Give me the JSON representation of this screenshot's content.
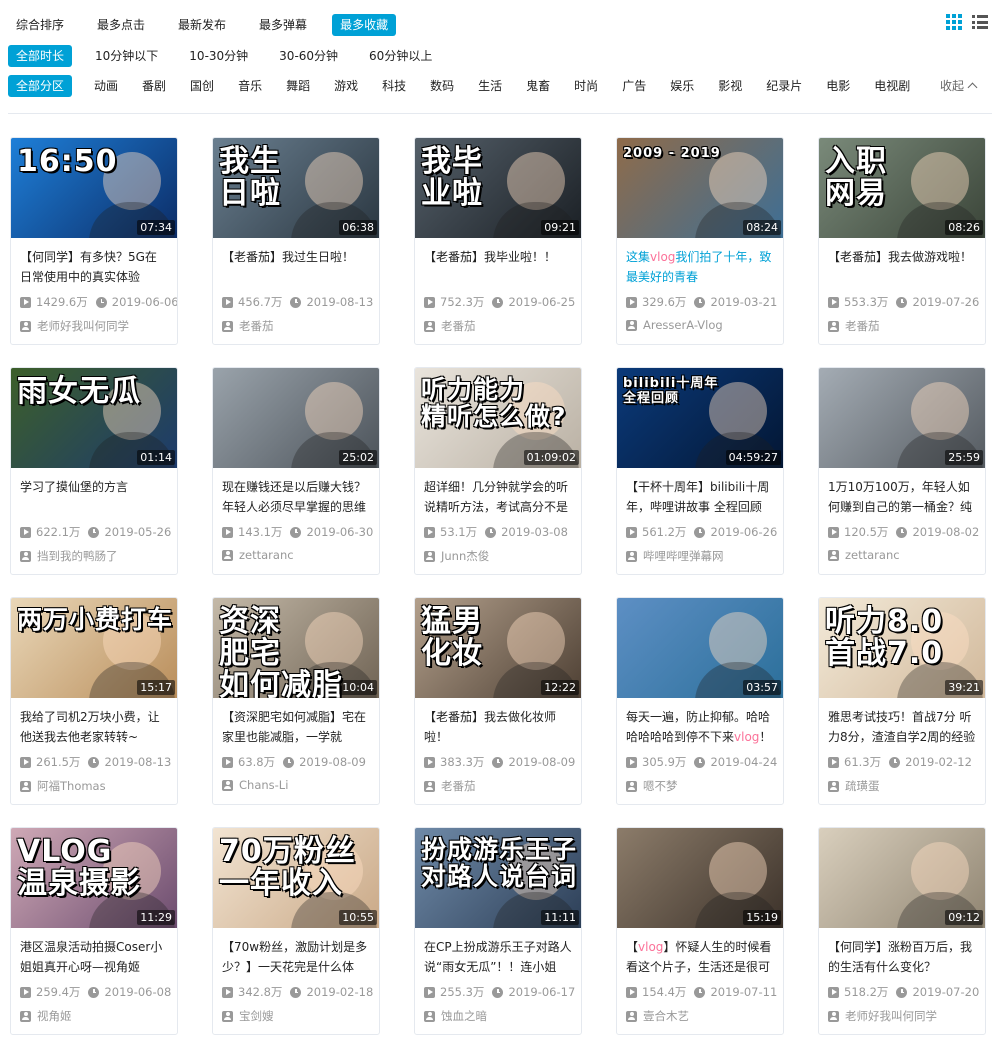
{
  "sort_tabs": [
    {
      "label": "综合排序",
      "active": false
    },
    {
      "label": "最多点击",
      "active": false
    },
    {
      "label": "最新发布",
      "active": false
    },
    {
      "label": "最多弹幕",
      "active": false
    },
    {
      "label": "最多收藏",
      "active": true
    }
  ],
  "duration_filters": [
    {
      "label": "全部时长",
      "active": true
    },
    {
      "label": "10分钟以下",
      "active": false
    },
    {
      "label": "10-30分钟",
      "active": false
    },
    {
      "label": "30-60分钟",
      "active": false
    },
    {
      "label": "60分钟以上",
      "active": false
    }
  ],
  "zone_filters": [
    {
      "label": "全部分区",
      "active": true
    },
    {
      "label": "动画",
      "active": false
    },
    {
      "label": "番剧",
      "active": false
    },
    {
      "label": "国创",
      "active": false
    },
    {
      "label": "音乐",
      "active": false
    },
    {
      "label": "舞蹈",
      "active": false
    },
    {
      "label": "游戏",
      "active": false
    },
    {
      "label": "科技",
      "active": false
    },
    {
      "label": "数码",
      "active": false
    },
    {
      "label": "生活",
      "active": false
    },
    {
      "label": "鬼畜",
      "active": false
    },
    {
      "label": "时尚",
      "active": false
    },
    {
      "label": "广告",
      "active": false
    },
    {
      "label": "娱乐",
      "active": false
    },
    {
      "label": "影视",
      "active": false
    },
    {
      "label": "纪录片",
      "active": false
    },
    {
      "label": "电影",
      "active": false
    },
    {
      "label": "电视剧",
      "active": false
    }
  ],
  "collapse_label": "收起",
  "colors": {
    "accent": "#00a1d6",
    "highlight_pink": "#fb7299"
  },
  "videos": [
    {
      "title_parts": [
        [
          "【何同学】有多快？5G在日常使用中的真实体验",
          ""
        ]
      ],
      "thumb_text": "16:50",
      "duration": "07:34",
      "views": "1429.6万",
      "date": "2019-06-06",
      "author": "老师好我叫何同学",
      "bg": [
        "#1e7fd8",
        "#0c2c66"
      ]
    },
    {
      "title_parts": [
        [
          "【老番茄】我过生日啦！",
          ""
        ]
      ],
      "thumb_text": "我生\n日啦",
      "duration": "06:38",
      "views": "456.7万",
      "date": "2019-08-13",
      "author": "老番茄",
      "bg": [
        "#6a7f90",
        "#2a3640"
      ]
    },
    {
      "title_parts": [
        [
          "【老番茄】我毕业啦！！",
          ""
        ]
      ],
      "thumb_text": "我毕\n业啦",
      "duration": "09:21",
      "views": "752.3万",
      "date": "2019-06-25",
      "author": "老番茄",
      "bg": [
        "#55606a",
        "#1a1f24"
      ]
    },
    {
      "title_parts": [
        [
          "这集",
          "hl"
        ],
        [
          "vlog",
          "hl2"
        ],
        [
          "我们拍了十年，致最美好的青春",
          "hl"
        ]
      ],
      "thumb_text": "2009 - 2019",
      "duration": "08:24",
      "views": "329.6万",
      "date": "2019-03-21",
      "author": "AresserA-Vlog",
      "bg": [
        "#8f6b4a",
        "#3d6f96"
      ]
    },
    {
      "title_parts": [
        [
          "【老番茄】我去做游戏啦！",
          ""
        ]
      ],
      "thumb_text": "入职\n网易",
      "duration": "08:26",
      "views": "553.3万",
      "date": "2019-07-26",
      "author": "老番茄",
      "bg": [
        "#7a8a7a",
        "#3a4438"
      ]
    },
    {
      "title_parts": [
        [
          "学习了摸仙堡的方言",
          ""
        ]
      ],
      "thumb_text": "雨女无瓜",
      "duration": "01:14",
      "views": "622.1万",
      "date": "2019-05-26",
      "author": "挡到我的鸭肠了",
      "bg": [
        "#3d5f2a",
        "#1c3a6d"
      ]
    },
    {
      "title_parts": [
        [
          "现在赚钱还是以后赚大钱？年轻人必须尽早掌握的思维",
          ""
        ]
      ],
      "thumb_text": "",
      "duration": "25:02",
      "views": "143.1万",
      "date": "2019-06-30",
      "author": "zettaranc",
      "bg": [
        "#9aa3ab",
        "#4b5259"
      ]
    },
    {
      "title_parts": [
        [
          "超详细！几分钟就学会的听说精听方法，考试高分不是梦",
          ""
        ]
      ],
      "thumb_text": "听力能力\n精听怎么做?",
      "duration": "01:09:02",
      "views": "53.1万",
      "date": "2019-03-08",
      "author": "Junn杰俊",
      "bg": [
        "#e9e4dc",
        "#b9b0a3"
      ]
    },
    {
      "title_parts": [
        [
          "【干杯十周年】bilibili十周年，哔哩讲故事 全程回顾",
          ""
        ]
      ],
      "thumb_text": "bilibili十周年\n全程回顾",
      "duration": "04:59:27",
      "views": "561.2万",
      "date": "2019-06-26",
      "author": "哔哩哔哩弹幕网",
      "bg": [
        "#0b3a7a",
        "#031633"
      ]
    },
    {
      "title_parts": [
        [
          "1万10万100万，年轻人如何赚到自己的第一桶金？纯",
          ""
        ]
      ],
      "thumb_text": "",
      "duration": "25:59",
      "views": "120.5万",
      "date": "2019-08-02",
      "author": "zettaranc",
      "bg": [
        "#a4acb4",
        "#545a60"
      ]
    },
    {
      "title_parts": [
        [
          "我给了司机2万块小费，让他送我去他老家转转~",
          ""
        ]
      ],
      "thumb_text": "两万小费打车",
      "duration": "15:17",
      "views": "261.5万",
      "date": "2019-08-13",
      "author": "阿福Thomas",
      "bg": [
        "#e9d7b8",
        "#b98d5a"
      ]
    },
    {
      "title_parts": [
        [
          "【资深肥宅如何减脂】宅在家里也能减脂，一学就",
          ""
        ]
      ],
      "thumb_text": "资深\n肥宅\n如何减脂",
      "duration": "10:04",
      "views": "63.8万",
      "date": "2019-08-09",
      "author": "Chans-Li",
      "bg": [
        "#c4b9a8",
        "#6f6354"
      ]
    },
    {
      "title_parts": [
        [
          "【老番茄】我去做化妆师啦！",
          ""
        ]
      ],
      "thumb_text": "猛男\n化妆",
      "duration": "12:22",
      "views": "383.3万",
      "date": "2019-08-09",
      "author": "老番茄",
      "bg": [
        "#b3a08c",
        "#4d3f33"
      ]
    },
    {
      "title_parts": [
        [
          "每天一遍，防止抑郁。哈哈哈哈哈哈到停不下来",
          ""
        ],
        [
          "vlog",
          "hl2"
        ],
        [
          "！",
          ""
        ]
      ],
      "thumb_text": "",
      "duration": "03:57",
      "views": "305.9万",
      "date": "2019-04-24",
      "author": "嗯不梦",
      "bg": [
        "#5d8fc4",
        "#2b6f9a"
      ]
    },
    {
      "title_parts": [
        [
          "雅思考试技巧！首战7分 听力8分，渣渣自学2周的经验",
          ""
        ]
      ],
      "thumb_text": "听力8.0\n首战7.0",
      "duration": "39:21",
      "views": "61.3万",
      "date": "2019-02-12",
      "author": "疏璜蛋",
      "bg": [
        "#f3ead9",
        "#d1b89a"
      ]
    },
    {
      "title_parts": [
        [
          "港区温泉活动拍摄Coser小姐姐真开心呀—视角姬",
          ""
        ]
      ],
      "thumb_text": "VLOG\n温泉摄影",
      "duration": "11:29",
      "views": "259.4万",
      "date": "2019-06-08",
      "author": "视角姬",
      "bg": [
        "#cfa9b6",
        "#6b4b6e"
      ]
    },
    {
      "title_parts": [
        [
          "【70w粉丝，激励计划是多少？】一天花完是什么体",
          ""
        ]
      ],
      "thumb_text": "70万粉丝\n一年收入",
      "duration": "10:55",
      "views": "342.8万",
      "date": "2019-02-18",
      "author": "宝剑嫂",
      "bg": [
        "#f2e4d2",
        "#c9a886"
      ]
    },
    {
      "title_parts": [
        [
          "在CP上扮成游乐王子对路人说“雨女无瓜”！！连小姐",
          ""
        ]
      ],
      "thumb_text": "扮成游乐王子\n对路人说台词",
      "duration": "11:11",
      "views": "255.3万",
      "date": "2019-06-17",
      "author": "蚀血之暗",
      "bg": [
        "#6f8aa8",
        "#2c3e56"
      ]
    },
    {
      "title_parts": [
        [
          "【",
          ""
        ],
        [
          "vlog",
          "hl2"
        ],
        [
          "】怀疑人生的时候看看这个片子，生活还是很可",
          ""
        ]
      ],
      "thumb_text": "",
      "duration": "15:19",
      "views": "154.4万",
      "date": "2019-07-11",
      "author": "壹合木艺",
      "bg": [
        "#8c7c6a",
        "#3b3129"
      ]
    },
    {
      "title_parts": [
        [
          "【何同学】涨粉百万后，我的生活有什么变化？",
          ""
        ]
      ],
      "thumb_text": "",
      "duration": "09:12",
      "views": "518.2万",
      "date": "2019-07-20",
      "author": "老师好我叫何同学",
      "bg": [
        "#d9cfbd",
        "#8f8471"
      ]
    }
  ]
}
